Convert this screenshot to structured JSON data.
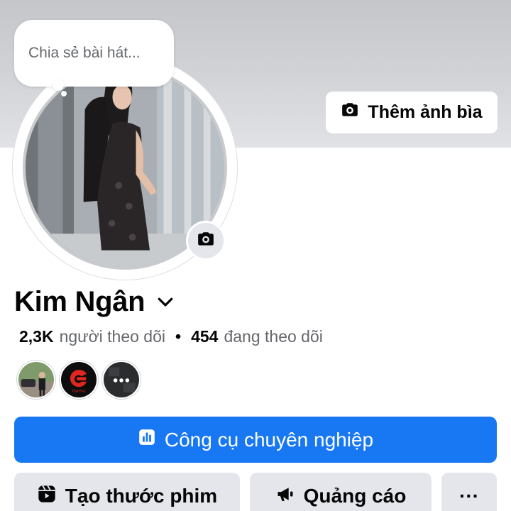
{
  "cover": {
    "add_cover_label": "Thêm ảnh bìa",
    "button_icon": "camera-icon"
  },
  "note": {
    "placeholder": "Chia sẻ bài hát..."
  },
  "profile": {
    "name": "Kim Ngân",
    "followers_count": "2,3K",
    "followers_label": "người theo dõi",
    "separator": "•",
    "following_count": "454",
    "following_label": "đang theo dõi"
  },
  "friends": [
    {
      "name": "friend-avatar-1"
    },
    {
      "name": "friend-avatar-garena",
      "badge_text": "Garena"
    },
    {
      "name": "friend-avatar-more"
    }
  ],
  "actions": {
    "pro_tools_label": "Công cụ chuyên nghiệp",
    "create_reel_label": "Tạo thước phim",
    "ads_label": "Quảng cáo",
    "more_label": "···"
  },
  "colors": {
    "primary": "#1877f2",
    "secondary_button": "#e4e6eb",
    "text_primary": "#050505",
    "text_secondary": "#65676b"
  }
}
